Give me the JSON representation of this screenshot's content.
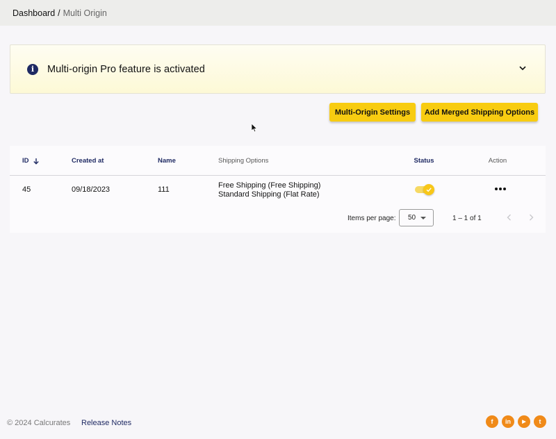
{
  "breadcrumb": {
    "parent": "Dashboard",
    "separator": "/",
    "current": "Multi Origin"
  },
  "banner": {
    "icon": "info-icon",
    "text": "Multi-origin Pro feature is activated",
    "expand_icon": "chevron-down-icon"
  },
  "actions": {
    "settings_label": "Multi-Origin Settings",
    "merge_label": "Add Merged Shipping Options"
  },
  "table": {
    "columns": {
      "id": "ID",
      "created_at": "Created at",
      "name": "Name",
      "shipping_options": "Shipping Options",
      "status": "Status",
      "action": "Action"
    },
    "sort": {
      "column": "ID",
      "direction": "descending",
      "icon": "arrow-down-icon"
    },
    "rows": [
      {
        "id": "45",
        "created_at": "09/18/2023",
        "name": "111",
        "shipping_options": [
          "Free Shipping (Free Shipping)",
          "Standard Shipping (Flat Rate)"
        ],
        "status_enabled": true,
        "action_icon": "more-horizontal-icon"
      }
    ]
  },
  "paginator": {
    "items_per_page_label": "Items per page:",
    "items_per_page": "50",
    "range": "1 – 1 of 1"
  },
  "footer": {
    "copyright": "© 2024 Calcurates",
    "release_notes": "Release Notes",
    "social": [
      {
        "name": "facebook-icon",
        "glyph": "f"
      },
      {
        "name": "linkedin-icon",
        "glyph": "in"
      },
      {
        "name": "youtube-icon",
        "glyph": "▶"
      },
      {
        "name": "twitter-icon",
        "glyph": "t"
      }
    ]
  },
  "colors": {
    "accent": "#f8cc11",
    "navy": "#1f2a63",
    "social": "#f08a19"
  }
}
